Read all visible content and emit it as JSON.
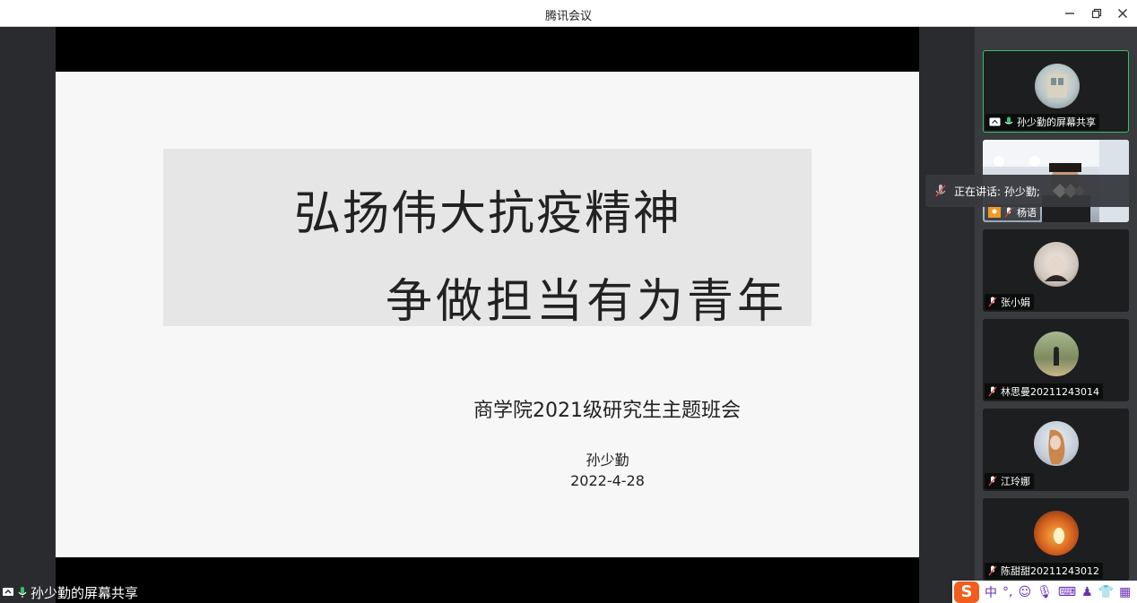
{
  "window": {
    "title": "腾讯会议"
  },
  "slide": {
    "title_line1": "弘扬伟大抗疫精神",
    "title_line2": "争做担当有为青年",
    "subtitle": "商学院2021级研究生主题班会",
    "presenter": "孙少勤",
    "date": "2022-4-28"
  },
  "share_label": "孙少勤的屏幕共享",
  "speaking_banner": {
    "prefix": "正在讲话: ",
    "name": "孙少勤;"
  },
  "participants": [
    {
      "name": "孙少勤的屏幕共享",
      "mic": "on",
      "active": true
    },
    {
      "name": "杨语",
      "mic": "muted",
      "video": true
    },
    {
      "name": "张小娟",
      "mic": "muted"
    },
    {
      "name": "林思曼20211243014",
      "mic": "muted"
    },
    {
      "name": "江玲娜",
      "mic": "muted"
    },
    {
      "name": "陈甜甜20211243012",
      "mic": "muted"
    }
  ],
  "ime": {
    "logo": "S",
    "mode": "中"
  },
  "colors": {
    "active_border": "#33c36a",
    "ime_logo": "#f25c1c",
    "ime_icon": "#6a2fb7"
  }
}
